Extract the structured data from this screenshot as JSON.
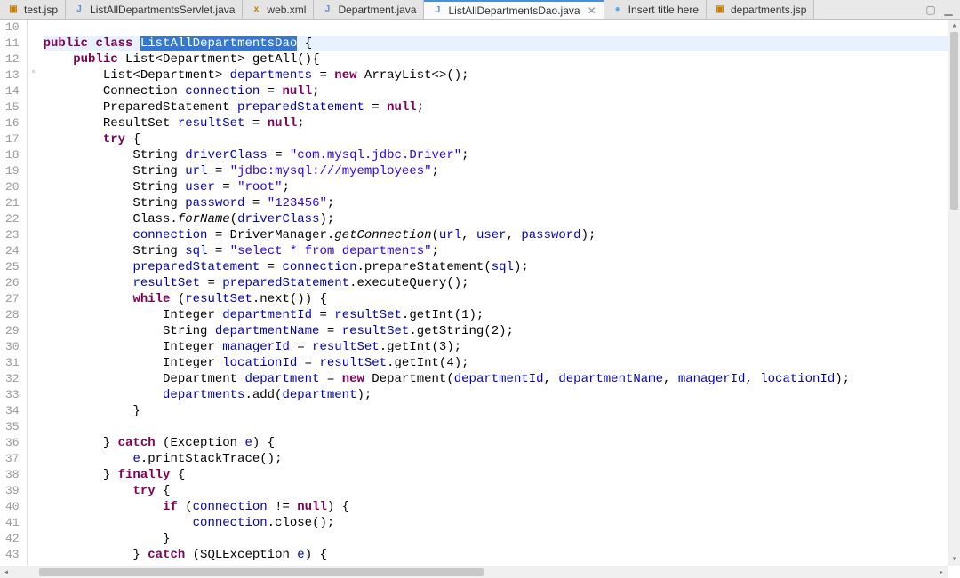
{
  "tabs": [
    {
      "icon": "jsp-icon",
      "label": "test.jsp",
      "active": false
    },
    {
      "icon": "java-icon",
      "label": "ListAllDepartmentsServlet.java",
      "active": false
    },
    {
      "icon": "xml-icon",
      "label": "web.xml",
      "active": false
    },
    {
      "icon": "java-icon",
      "label": "Department.java",
      "active": false
    },
    {
      "icon": "java-icon",
      "label": "ListAllDepartmentsDao.java",
      "active": true
    },
    {
      "icon": "web-icon",
      "label": "Insert title here",
      "active": false
    },
    {
      "icon": "jsp-icon",
      "label": "departments.jsp",
      "active": false
    }
  ],
  "lineStart": 10,
  "lineCount": 34,
  "highlightLine": 11,
  "code": {
    "10": {
      "t": "󠀠"
    },
    "11": {
      "t": "public class ListAllDepartmentsDao {",
      "tokens": [
        [
          "kw",
          "public"
        ],
        [
          "sp",
          " "
        ],
        [
          "kw",
          "class"
        ],
        [
          "sp",
          " "
        ],
        [
          "sel",
          "ListAllDepartmentsDao"
        ],
        [
          "sp",
          " {"
        ]
      ]
    },
    "12": {
      "t": "    public List<Department> getAll(){",
      "tokens": [
        [
          "sp",
          "    "
        ],
        [
          "kw",
          "public"
        ],
        [
          "sp",
          " List<Department> getAll(){"
        ]
      ]
    },
    "13": {
      "t": "        List<Department> departments = new ArrayList<>();",
      "tokens": [
        [
          "sp",
          "        List<Department> "
        ],
        [
          "fld",
          "departments"
        ],
        [
          "sp",
          " = "
        ],
        [
          "kw",
          "new"
        ],
        [
          "sp",
          " ArrayList<>();"
        ]
      ]
    },
    "14": {
      "t": "        Connection connection = null;",
      "tokens": [
        [
          "sp",
          "        Connection "
        ],
        [
          "fld",
          "connection"
        ],
        [
          "sp",
          " = "
        ],
        [
          "kw",
          "null"
        ],
        [
          "sp",
          ";"
        ]
      ]
    },
    "15": {
      "t": "        PreparedStatement preparedStatement = null;",
      "tokens": [
        [
          "sp",
          "        PreparedStatement "
        ],
        [
          "fld",
          "preparedStatement"
        ],
        [
          "sp",
          " = "
        ],
        [
          "kw",
          "null"
        ],
        [
          "sp",
          ";"
        ]
      ]
    },
    "16": {
      "t": "        ResultSet resultSet = null;",
      "tokens": [
        [
          "sp",
          "        ResultSet "
        ],
        [
          "fld",
          "resultSet"
        ],
        [
          "sp",
          " = "
        ],
        [
          "kw",
          "null"
        ],
        [
          "sp",
          ";"
        ]
      ]
    },
    "17": {
      "t": "        try {",
      "tokens": [
        [
          "sp",
          "        "
        ],
        [
          "kw",
          "try"
        ],
        [
          "sp",
          " {"
        ]
      ]
    },
    "18": {
      "t": "            String driverClass = \"com.mysql.jdbc.Driver\";",
      "tokens": [
        [
          "sp",
          "            String "
        ],
        [
          "fld",
          "driverClass"
        ],
        [
          "sp",
          " = "
        ],
        [
          "str",
          "\"com.mysql.jdbc.Driver\""
        ],
        [
          "sp",
          ";"
        ]
      ]
    },
    "19": {
      "t": "            String url = \"jdbc:mysql:///myemployees\";",
      "tokens": [
        [
          "sp",
          "            String "
        ],
        [
          "fld",
          "url"
        ],
        [
          "sp",
          " = "
        ],
        [
          "str",
          "\"jdbc:mysql:///myemployees\""
        ],
        [
          "sp",
          ";"
        ]
      ]
    },
    "20": {
      "t": "            String user = \"root\";",
      "tokens": [
        [
          "sp",
          "            String "
        ],
        [
          "fld",
          "user"
        ],
        [
          "sp",
          " = "
        ],
        [
          "str",
          "\"root\""
        ],
        [
          "sp",
          ";"
        ]
      ]
    },
    "21": {
      "t": "            String password = \"123456\";",
      "tokens": [
        [
          "sp",
          "            String "
        ],
        [
          "fld",
          "password"
        ],
        [
          "sp",
          " = "
        ],
        [
          "str",
          "\"123456\""
        ],
        [
          "sp",
          ";"
        ]
      ]
    },
    "22": {
      "t": "            Class.forName(driverClass);",
      "tokens": [
        [
          "sp",
          "            Class."
        ],
        [
          "it",
          "forName"
        ],
        [
          "sp",
          "("
        ],
        [
          "fld",
          "driverClass"
        ],
        [
          "sp",
          ");"
        ]
      ]
    },
    "23": {
      "t": "            connection = DriverManager.getConnection(url, user, password);",
      "tokens": [
        [
          "sp",
          "            "
        ],
        [
          "fld",
          "connection"
        ],
        [
          "sp",
          " = DriverManager."
        ],
        [
          "it",
          "getConnection"
        ],
        [
          "sp",
          "("
        ],
        [
          "fld",
          "url"
        ],
        [
          "sp",
          ", "
        ],
        [
          "fld",
          "user"
        ],
        [
          "sp",
          ", "
        ],
        [
          "fld",
          "password"
        ],
        [
          "sp",
          ");"
        ]
      ]
    },
    "24": {
      "t": "            String sql = \"select * from departments\";",
      "tokens": [
        [
          "sp",
          "            String "
        ],
        [
          "fld",
          "sql"
        ],
        [
          "sp",
          " = "
        ],
        [
          "str",
          "\"select * from departments\""
        ],
        [
          "sp",
          ";"
        ]
      ]
    },
    "25": {
      "t": "            preparedStatement = connection.prepareStatement(sql);",
      "tokens": [
        [
          "sp",
          "            "
        ],
        [
          "fld",
          "preparedStatement"
        ],
        [
          "sp",
          " = "
        ],
        [
          "fld",
          "connection"
        ],
        [
          "sp",
          ".prepareStatement("
        ],
        [
          "fld",
          "sql"
        ],
        [
          "sp",
          ");"
        ]
      ]
    },
    "26": {
      "t": "            resultSet = preparedStatement.executeQuery();",
      "tokens": [
        [
          "sp",
          "            "
        ],
        [
          "fld",
          "resultSet"
        ],
        [
          "sp",
          " = "
        ],
        [
          "fld",
          "preparedStatement"
        ],
        [
          "sp",
          ".executeQuery();"
        ]
      ]
    },
    "27": {
      "t": "            while (resultSet.next()) {",
      "tokens": [
        [
          "sp",
          "            "
        ],
        [
          "kw",
          "while"
        ],
        [
          "sp",
          " ("
        ],
        [
          "fld",
          "resultSet"
        ],
        [
          "sp",
          ".next()) {"
        ]
      ]
    },
    "28": {
      "t": "                Integer departmentId = resultSet.getInt(1);",
      "tokens": [
        [
          "sp",
          "                Integer "
        ],
        [
          "fld",
          "departmentId"
        ],
        [
          "sp",
          " = "
        ],
        [
          "fld",
          "resultSet"
        ],
        [
          "sp",
          ".getInt(1);"
        ]
      ]
    },
    "29": {
      "t": "                String departmentName = resultSet.getString(2);",
      "tokens": [
        [
          "sp",
          "                String "
        ],
        [
          "fld",
          "departmentName"
        ],
        [
          "sp",
          " = "
        ],
        [
          "fld",
          "resultSet"
        ],
        [
          "sp",
          ".getString(2);"
        ]
      ]
    },
    "30": {
      "t": "                Integer managerId = resultSet.getInt(3);",
      "tokens": [
        [
          "sp",
          "                Integer "
        ],
        [
          "fld",
          "managerId"
        ],
        [
          "sp",
          " = "
        ],
        [
          "fld",
          "resultSet"
        ],
        [
          "sp",
          ".getInt(3);"
        ]
      ]
    },
    "31": {
      "t": "                Integer locationId = resultSet.getInt(4);",
      "tokens": [
        [
          "sp",
          "                Integer "
        ],
        [
          "fld",
          "locationId"
        ],
        [
          "sp",
          " = "
        ],
        [
          "fld",
          "resultSet"
        ],
        [
          "sp",
          ".getInt(4);"
        ]
      ]
    },
    "32": {
      "t": "                Department department = new Department(departmentId, departmentName, managerId, locationId);",
      "tokens": [
        [
          "sp",
          "                Department "
        ],
        [
          "fld",
          "department"
        ],
        [
          "sp",
          " = "
        ],
        [
          "kw",
          "new"
        ],
        [
          "sp",
          " Department("
        ],
        [
          "fld",
          "departmentId"
        ],
        [
          "sp",
          ", "
        ],
        [
          "fld",
          "departmentName"
        ],
        [
          "sp",
          ", "
        ],
        [
          "fld",
          "managerId"
        ],
        [
          "sp",
          ", "
        ],
        [
          "fld",
          "locationId"
        ],
        [
          "sp",
          ");"
        ]
      ]
    },
    "33": {
      "t": "                departments.add(department);",
      "tokens": [
        [
          "sp",
          "                "
        ],
        [
          "fld",
          "departments"
        ],
        [
          "sp",
          ".add("
        ],
        [
          "fld",
          "department"
        ],
        [
          "sp",
          ");"
        ]
      ]
    },
    "34": {
      "t": "            }",
      "tokens": [
        [
          "sp",
          "            }"
        ]
      ]
    },
    "35": {
      "t": "",
      "tokens": []
    },
    "36": {
      "t": "        } catch (Exception e) {",
      "tokens": [
        [
          "sp",
          "        } "
        ],
        [
          "kw",
          "catch"
        ],
        [
          "sp",
          " (Exception "
        ],
        [
          "fld",
          "e"
        ],
        [
          "sp",
          ") {"
        ]
      ]
    },
    "37": {
      "t": "            e.printStackTrace();",
      "tokens": [
        [
          "sp",
          "            "
        ],
        [
          "fld",
          "e"
        ],
        [
          "sp",
          ".printStackTrace();"
        ]
      ]
    },
    "38": {
      "t": "        } finally {",
      "tokens": [
        [
          "sp",
          "        } "
        ],
        [
          "kw",
          "finally"
        ],
        [
          "sp",
          " {"
        ]
      ]
    },
    "39": {
      "t": "            try {",
      "tokens": [
        [
          "sp",
          "            "
        ],
        [
          "kw",
          "try"
        ],
        [
          "sp",
          " {"
        ]
      ]
    },
    "40": {
      "t": "                if (connection != null) {",
      "tokens": [
        [
          "sp",
          "                "
        ],
        [
          "kw",
          "if"
        ],
        [
          "sp",
          " ("
        ],
        [
          "fld",
          "connection"
        ],
        [
          "sp",
          " != "
        ],
        [
          "kw",
          "null"
        ],
        [
          "sp",
          ") {"
        ]
      ]
    },
    "41": {
      "t": "                    connection.close();",
      "tokens": [
        [
          "sp",
          "                    "
        ],
        [
          "fld",
          "connection"
        ],
        [
          "sp",
          ".close();"
        ]
      ]
    },
    "42": {
      "t": "                }",
      "tokens": [
        [
          "sp",
          "                }"
        ]
      ]
    },
    "43": {
      "t": "            } catch (SQLException e) {",
      "tokens": [
        [
          "sp",
          "            } "
        ],
        [
          "kw",
          "catch"
        ],
        [
          "sp",
          " (SQLException "
        ],
        [
          "fld",
          "e"
        ],
        [
          "sp",
          ") {"
        ]
      ]
    }
  },
  "annotations": {
    "12": "◦"
  },
  "iconColors": {
    "jsp-icon": "#c77d00",
    "java-icon": "#5a8ecf",
    "xml-icon": "#c77d00",
    "web-icon": "#5aa8e0"
  }
}
